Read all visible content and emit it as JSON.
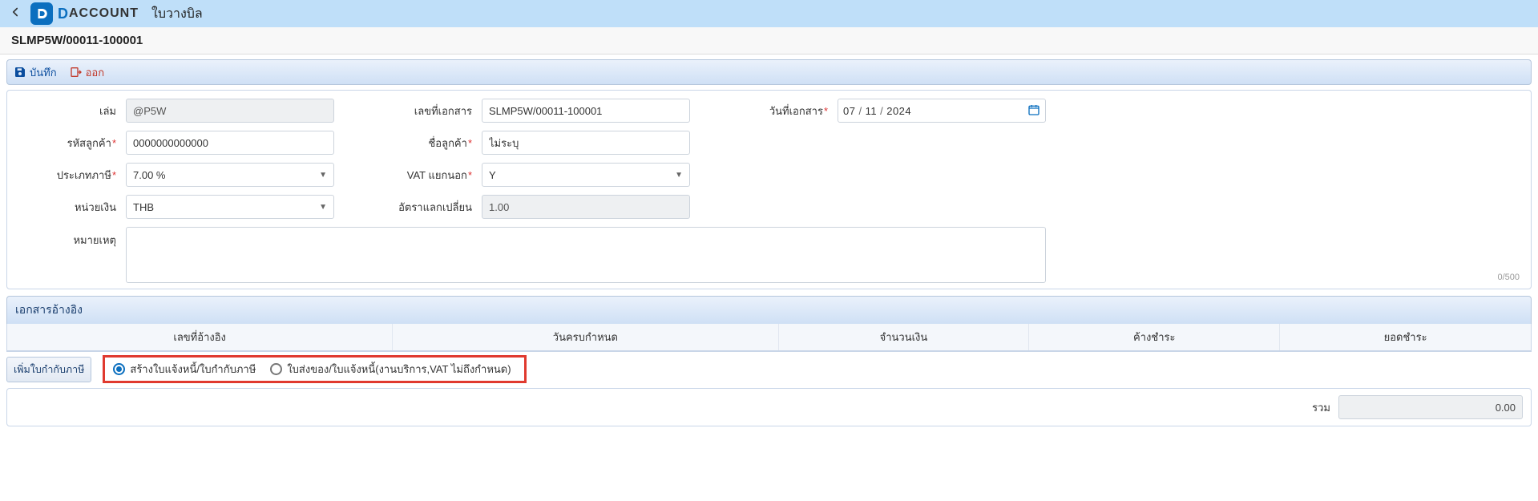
{
  "header": {
    "page_title": "ใบวางบิล",
    "logo_d": "D",
    "logo_rest": "ACCOUNT"
  },
  "sub_header": {
    "doc_code": "SLMP5W/00011-100001"
  },
  "toolbar": {
    "save_label": "บันทึก",
    "exit_label": "ออก"
  },
  "form": {
    "book_label": "เล่ม",
    "book_value": "@P5W",
    "docno_label": "เลขที่เอกสาร",
    "docno_value": "SLMP5W/00011-100001",
    "docdate_label": "วันที่เอกสาร",
    "docdate_day": "07",
    "docdate_month": "11",
    "docdate_year": "2024",
    "custcode_label": "รหัสลูกค้า",
    "custcode_value": "0000000000000",
    "custname_label": "ชื่อลูกค้า",
    "custname_value": "ไม่ระบุ",
    "taxtype_label": "ประเภทภาษี",
    "taxtype_value": "7.00 %",
    "vatext_label": "VAT แยกนอก",
    "vatext_value": "Y",
    "currency_label": "หน่วยเงิน",
    "currency_value": "THB",
    "exrate_label": "อัตราแลกเปลี่ยน",
    "exrate_value": "1.00",
    "remark_label": "หมายเหตุ",
    "remark_value": "",
    "char_count": "0/500"
  },
  "ref": {
    "section_title": "เอกสารอ้างอิง",
    "col_refno": "เลขที่อ้างอิง",
    "col_due": "วันครบกำหนด",
    "col_amount": "จำนวนเงิน",
    "col_remain": "ค้างชำระ",
    "col_pay": "ยอดชำระ"
  },
  "radio": {
    "add_btn": "เพิ่มใบกำกับภาษี",
    "opt1": "สร้างใบแจ้งหนี้/ใบกำกับภาษี",
    "opt2": "ใบส่งของ/ใบแจ้งหนี้(งานบริการ,VAT ไม่ถึงกำหนด)"
  },
  "total": {
    "label": "รวม",
    "value": "0.00"
  }
}
